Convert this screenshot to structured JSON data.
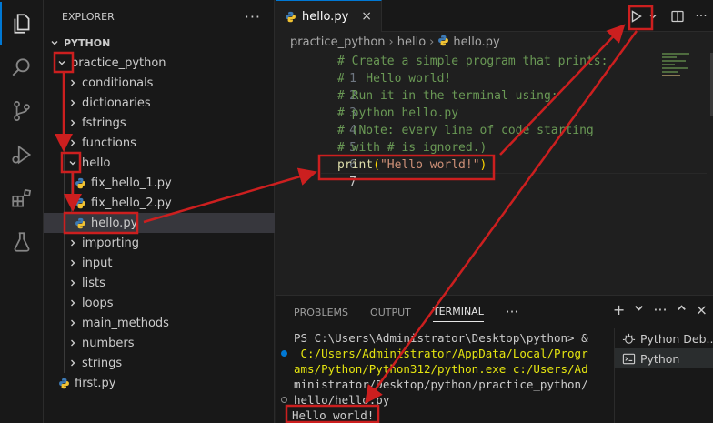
{
  "explorer": {
    "title": "EXPLORER",
    "more": "···",
    "root": "PYTHON",
    "items": [
      {
        "label": "practice_python"
      },
      {
        "label": "conditionals"
      },
      {
        "label": "dictionaries"
      },
      {
        "label": "fstrings"
      },
      {
        "label": "functions"
      },
      {
        "label": "hello"
      },
      {
        "label": "fix_hello_1.py"
      },
      {
        "label": "fix_hello_2.py"
      },
      {
        "label": "hello.py"
      },
      {
        "label": "importing"
      },
      {
        "label": "input"
      },
      {
        "label": "lists"
      },
      {
        "label": "loops"
      },
      {
        "label": "main_methods"
      },
      {
        "label": "numbers"
      },
      {
        "label": "strings"
      },
      {
        "label": "first.py"
      }
    ]
  },
  "editor": {
    "tab": {
      "label": "hello.py",
      "close": "×"
    },
    "breadcrumb": [
      "practice_python",
      "hello",
      "hello.py"
    ],
    "lines": [
      {
        "n": "1",
        "text": "# Create a simple program that prints:"
      },
      {
        "n": "2",
        "text": "#   Hello world!"
      },
      {
        "n": "3",
        "text": "# Run it in the terminal using:"
      },
      {
        "n": "4",
        "text": "# python hello.py"
      },
      {
        "n": "5",
        "text": "# (Note: every line of code starting"
      },
      {
        "n": "6",
        "text": "# with # is ignored.)"
      },
      {
        "n": "7",
        "fn": "print",
        "open": "(",
        "str": "\"Hello world!\"",
        "close": ")"
      }
    ]
  },
  "panel": {
    "tabs": [
      "PROBLEMS",
      "OUTPUT",
      "TERMINAL"
    ],
    "more": "···",
    "active_tab": "TERMINAL",
    "terminal_lines": [
      "PS C:\\Users\\Administrator\\Desktop\\python> &",
      " C:/Users/Administrator/AppData/Local/Progr",
      "ams/Python/Python312/python.exe c:/Users/Ad",
      "ministrator/Desktop/python/practice_python/",
      "hello/hello.py",
      "Hello world!"
    ],
    "terminals": [
      {
        "label": "Python Deb..."
      },
      {
        "label": "Python"
      }
    ]
  },
  "colors": {
    "annotation": "#cc1f1f",
    "accent": "#0078d4",
    "comment": "#6a9955",
    "string": "#ce9178",
    "function": "#dcdcaa"
  },
  "icons": [
    "files-icon",
    "search-icon",
    "source-control-icon",
    "run-debug-icon",
    "extensions-icon",
    "testing-icon",
    "run-icon",
    "split-editor-icon",
    "maximize-icon",
    "close-icon",
    "python-file-icon"
  ]
}
